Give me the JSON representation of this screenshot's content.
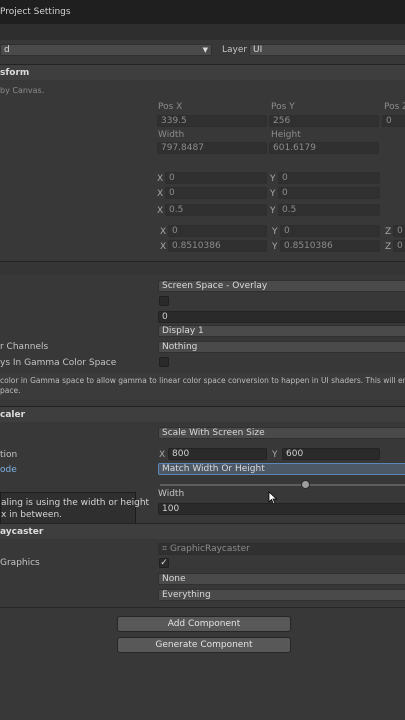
{
  "window": {
    "title": "Project Settings"
  },
  "gameobject": {
    "tag_value": "d",
    "layer_label": "Layer",
    "layer_value": "UI"
  },
  "rect_transform": {
    "title": "sform",
    "note": "by Canvas.",
    "pos_x_label": "Pos X",
    "pos_y_label": "Pos Y",
    "pos_z_label": "Pos Z",
    "pos_x": "339.5",
    "pos_y": "256",
    "pos_z": "0",
    "width_label": "Width",
    "height_label": "Height",
    "width": "797.8487",
    "height": "601.6179",
    "anchor_min_x": "0",
    "anchor_min_y": "0",
    "anchor_max_x": "0",
    "anchor_max_y": "0",
    "pivot_x": "0.5",
    "pivot_y": "0.5",
    "rot_x": "0",
    "rot_y": "0",
    "rot_z": "0",
    "scale_x": "0.8510386",
    "scale_y": "0.8510386",
    "scale_z": "0"
  },
  "canvas": {
    "render_mode": "Screen Space - Overlay",
    "sort_order": "0",
    "target_display": "Display 1",
    "additional_channels_label": "r Channels",
    "additional_channels_value": "Nothing",
    "gamma_label": "ys In Gamma Color Space",
    "info_line1": "color in Gamma space to allow gamma to linear color space conversion to happen in UI shaders. This will enhan",
    "info_line2": "pace."
  },
  "canvas_scaler": {
    "title": "caler",
    "ui_scale_mode": "Scale With Screen Size",
    "resolution_label": "tion",
    "ref_x": "800",
    "ref_y": "600",
    "screen_match_label": "ode",
    "screen_match_value": "Match Width Or Height",
    "match_value": 0.5,
    "tooltip_line1": "aling is using the width or height",
    "tooltip_line2": "x in between.",
    "width_label": "Width",
    "ppu": "100"
  },
  "graphic_raycaster": {
    "title": "aycaster",
    "script_value": "GraphicRaycaster",
    "ignore_label": "Graphics",
    "blocking_objects": "None",
    "blocking_mask": "Everything"
  },
  "buttons": {
    "add_component": "Add Component",
    "generate_component": "Generate Component"
  }
}
